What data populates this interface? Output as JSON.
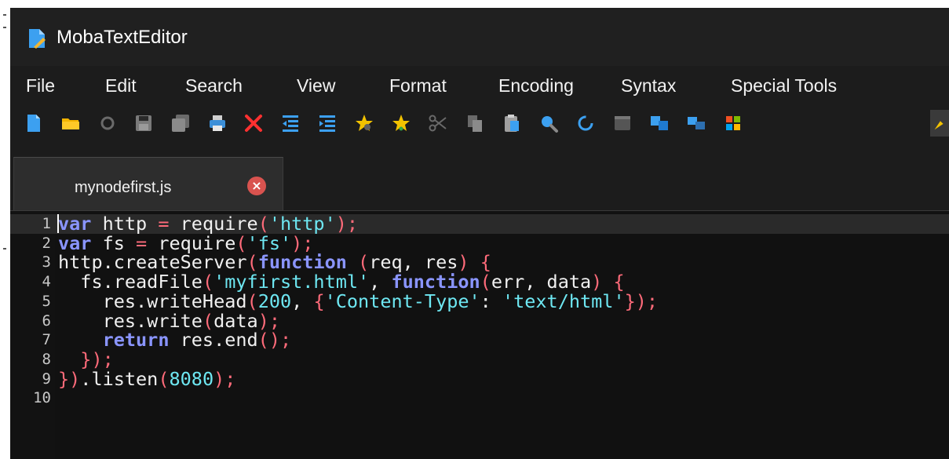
{
  "window": {
    "title": "MobaTextEditor"
  },
  "menu": {
    "items": [
      "File",
      "Edit",
      "Search",
      "View",
      "Format",
      "Encoding",
      "Syntax",
      "Special Tools"
    ]
  },
  "toolbar": {
    "buttons": [
      "new-file-icon",
      "open-folder-icon",
      "reload-icon",
      "save-icon",
      "save-all-icon",
      "print-icon",
      "close-x-icon",
      "indent-decrease-icon",
      "indent-increase-icon",
      "bookmark-toggle-icon",
      "bookmark-star-icon",
      "cut-icon",
      "copy-icon",
      "paste-icon",
      "search-icon",
      "refresh-icon",
      "terminal-icon",
      "compare-icon",
      "sync-icon",
      "windows-icon"
    ]
  },
  "tab": {
    "filename": "mynodefirst.js",
    "close_symbol": "×"
  },
  "editor": {
    "lines": [
      {
        "n": "1",
        "tokens": [
          [
            "kw",
            "var"
          ],
          [
            "pl",
            " http "
          ],
          [
            "pun",
            "="
          ],
          [
            "pl",
            " require"
          ],
          [
            "pun",
            "("
          ],
          [
            "str",
            "'http'"
          ],
          [
            "pun",
            ");"
          ]
        ]
      },
      {
        "n": "2",
        "tokens": [
          [
            "kw",
            "var"
          ],
          [
            "pl",
            " fs "
          ],
          [
            "pun",
            "="
          ],
          [
            "pl",
            " require"
          ],
          [
            "pun",
            "("
          ],
          [
            "str",
            "'fs'"
          ],
          [
            "pun",
            ");"
          ]
        ]
      },
      {
        "n": "3",
        "tokens": [
          [
            "pl",
            "http.createServer"
          ],
          [
            "pun",
            "("
          ],
          [
            "kw",
            "function"
          ],
          [
            "pl",
            " "
          ],
          [
            "pun",
            "("
          ],
          [
            "pl",
            "req, res"
          ],
          [
            "pun",
            ")"
          ],
          [
            "pl",
            " "
          ],
          [
            "pun",
            "{"
          ]
        ]
      },
      {
        "n": "4",
        "tokens": [
          [
            "pl",
            "  fs.readFile"
          ],
          [
            "pun",
            "("
          ],
          [
            "str",
            "'myfirst.html'"
          ],
          [
            "pl",
            ", "
          ],
          [
            "kw",
            "function"
          ],
          [
            "pun",
            "("
          ],
          [
            "pl",
            "err, data"
          ],
          [
            "pun",
            ")"
          ],
          [
            "pl",
            " "
          ],
          [
            "pun",
            "{"
          ]
        ]
      },
      {
        "n": "5",
        "tokens": [
          [
            "pl",
            "    res.writeHead"
          ],
          [
            "pun",
            "("
          ],
          [
            "num",
            "200"
          ],
          [
            "pl",
            ", "
          ],
          [
            "pun",
            "{"
          ],
          [
            "str",
            "'Content-Type'"
          ],
          [
            "pl",
            ": "
          ],
          [
            "str",
            "'text/html'"
          ],
          [
            "pun",
            "});"
          ]
        ]
      },
      {
        "n": "6",
        "tokens": [
          [
            "pl",
            "    res.write"
          ],
          [
            "pun",
            "("
          ],
          [
            "pl",
            "data"
          ],
          [
            "pun",
            ");"
          ]
        ]
      },
      {
        "n": "7",
        "tokens": [
          [
            "pl",
            "    "
          ],
          [
            "kw",
            "return"
          ],
          [
            "pl",
            " res.end"
          ],
          [
            "pun",
            "();"
          ]
        ]
      },
      {
        "n": "8",
        "tokens": [
          [
            "pl",
            "  "
          ],
          [
            "pun",
            "});"
          ]
        ]
      },
      {
        "n": "9",
        "tokens": [
          [
            "pun",
            "})"
          ],
          [
            "pl",
            ".listen"
          ],
          [
            "pun",
            "("
          ],
          [
            "num",
            "8080"
          ],
          [
            "pun",
            ");"
          ]
        ]
      },
      {
        "n": "10",
        "tokens": []
      }
    ]
  }
}
